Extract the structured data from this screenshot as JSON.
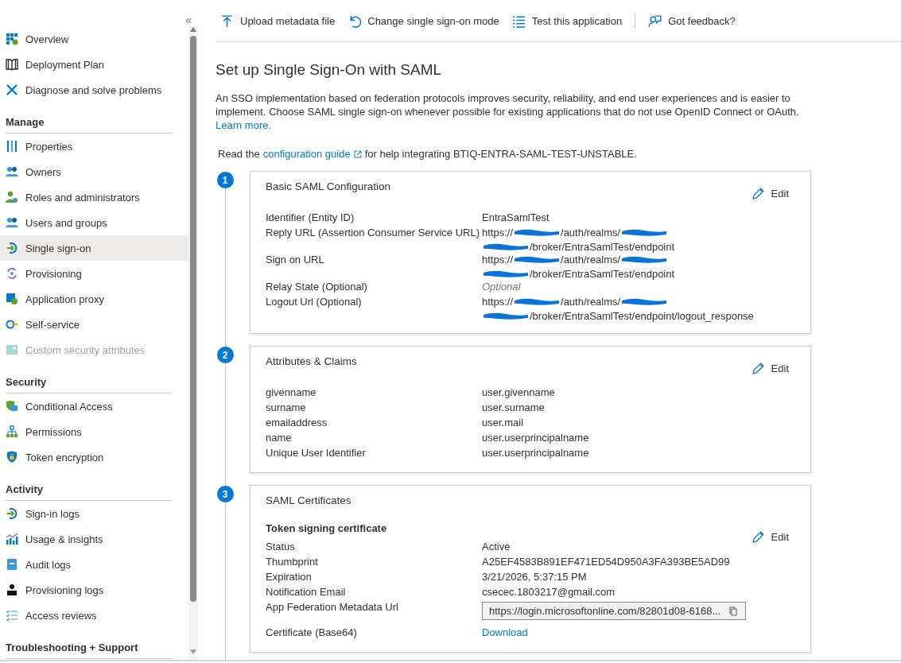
{
  "sidebar": {
    "collapse": "«",
    "groups": [
      {
        "items": [
          {
            "label": "Overview",
            "selected": false,
            "disabled": false
          },
          {
            "label": "Deployment Plan",
            "selected": false,
            "disabled": false
          },
          {
            "label": "Diagnose and solve problems",
            "selected": false,
            "disabled": false
          }
        ]
      },
      {
        "heading": "Manage",
        "items": [
          {
            "label": "Properties",
            "selected": false,
            "disabled": false
          },
          {
            "label": "Owners",
            "selected": false,
            "disabled": false
          },
          {
            "label": "Roles and administrators",
            "selected": false,
            "disabled": false
          },
          {
            "label": "Users and groups",
            "selected": false,
            "disabled": false
          },
          {
            "label": "Single sign-on",
            "selected": true,
            "disabled": false
          },
          {
            "label": "Provisioning",
            "selected": false,
            "disabled": false
          },
          {
            "label": "Application proxy",
            "selected": false,
            "disabled": false
          },
          {
            "label": "Self-service",
            "selected": false,
            "disabled": false
          },
          {
            "label": "Custom security attributes",
            "selected": false,
            "disabled": true
          }
        ]
      },
      {
        "heading": "Security",
        "items": [
          {
            "label": "Conditional Access",
            "selected": false,
            "disabled": false
          },
          {
            "label": "Permissions",
            "selected": false,
            "disabled": false
          },
          {
            "label": "Token encryption",
            "selected": false,
            "disabled": false
          }
        ]
      },
      {
        "heading": "Activity",
        "items": [
          {
            "label": "Sign-in logs",
            "selected": false,
            "disabled": false
          },
          {
            "label": "Usage & insights",
            "selected": false,
            "disabled": false
          },
          {
            "label": "Audit logs",
            "selected": false,
            "disabled": false
          },
          {
            "label": "Provisioning logs",
            "selected": false,
            "disabled": false
          },
          {
            "label": "Access reviews",
            "selected": false,
            "disabled": false
          }
        ]
      },
      {
        "heading": "Troubleshooting + Support"
      }
    ]
  },
  "toolbar": [
    {
      "label": "Upload metadata file"
    },
    {
      "label": "Change single sign-on mode"
    },
    {
      "label": "Test this application"
    },
    {
      "label": "Got feedback?"
    }
  ],
  "title": "Set up Single Sign-On with SAML",
  "intro": {
    "text": "An SSO implementation based on federation protocols improves security, reliability, and end user experiences and is easier to implement. Choose SAML single sign-on whenever possible for existing applications that do not use OpenID Connect or OAuth.",
    "link": "Learn more."
  },
  "guide": {
    "before": "Read the",
    "link": "configuration guide",
    "after": "for help integrating BTIQ-ENTRA-SAML-TEST-UNSTABLE."
  },
  "steps": [
    {
      "number": "1",
      "title": "Basic SAML Configuration",
      "edit": "Edit",
      "rows": [
        {
          "label": "Identifier (Entity ID)",
          "kind": "text",
          "value": "EntraSamlTest"
        },
        {
          "label": "Reply URL (Assertion Consumer Service URL)",
          "kind": "redacted",
          "lines": [
            [
              {
                "kind": "text",
                "text": "https://"
              },
              {
                "kind": "redacted"
              },
              {
                "kind": "text",
                "text": "/auth/realms/"
              },
              {
                "kind": "redacted"
              }
            ],
            [
              {
                "kind": "redacted"
              },
              {
                "kind": "text",
                "text": "/broker/EntraSamlTest/endpoint"
              }
            ]
          ]
        },
        {
          "label": "Sign on URL",
          "kind": "redacted",
          "lines": [
            [
              {
                "kind": "text",
                "text": "https://"
              },
              {
                "kind": "redacted"
              },
              {
                "kind": "text",
                "text": "/auth/realms/"
              },
              {
                "kind": "redacted"
              }
            ],
            [
              {
                "kind": "redacted"
              },
              {
                "kind": "text",
                "text": "/broker/EntraSamlTest/endpoint"
              }
            ]
          ]
        },
        {
          "label": "Relay State (Optional)",
          "kind": "hint",
          "placeholder": "Optional"
        },
        {
          "label": "Logout Url (Optional)",
          "kind": "redacted",
          "lines": [
            [
              {
                "kind": "text",
                "text": "https://"
              },
              {
                "kind": "redacted"
              },
              {
                "kind": "text",
                "text": "/auth/realms/"
              },
              {
                "kind": "redacted"
              }
            ],
            [
              {
                "kind": "redacted"
              },
              {
                "kind": "text",
                "text": "/broker/EntraSamlTest/endpoint/logout_response"
              }
            ]
          ]
        }
      ]
    },
    {
      "number": "2",
      "title": "Attributes & Claims",
      "edit": "Edit",
      "rows": [
        {
          "label": "givenname",
          "kind": "text",
          "value": "user.givenname"
        },
        {
          "label": "surname",
          "kind": "text",
          "value": "user.surname"
        },
        {
          "label": "emailaddress",
          "kind": "text",
          "value": "user.mail"
        },
        {
          "label": "name",
          "kind": "text",
          "value": "user.userprincipalname"
        },
        {
          "label": "Unique User Identifier",
          "kind": "text",
          "value": "user.userprincipalname"
        }
      ]
    },
    {
      "number": "3",
      "title": "SAML Certificates",
      "subtitle": "Token signing certificate",
      "edit": "Edit",
      "rows": [
        {
          "label": "Status",
          "kind": "text",
          "value": "Active"
        },
        {
          "label": "Thumbprint",
          "kind": "text",
          "value": "A25EF4583B891EF471ED54D950A3FA393BE5AD99"
        },
        {
          "label": "Expiration",
          "kind": "text",
          "value": "3/21/2026, 5:37:15 PM"
        },
        {
          "label": "Notification Email",
          "kind": "text",
          "value": "csecec.1803217@gmail.com"
        },
        {
          "label": "App Federation Metadata Url",
          "kind": "copy",
          "value": "https://login.microsoftonline.com/82801d08-6168..."
        },
        {
          "label": "Certificate (Base64)",
          "kind": "link",
          "value": "Download"
        }
      ]
    }
  ]
}
